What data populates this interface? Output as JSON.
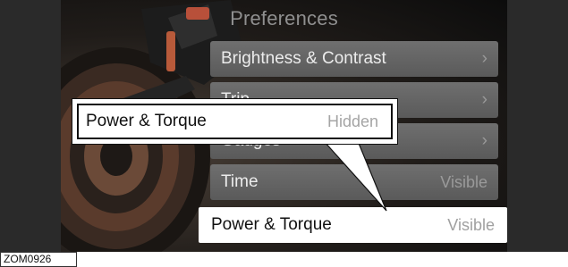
{
  "screen": {
    "title": "Preferences"
  },
  "menu": {
    "items": [
      {
        "label": "Brightness & Contrast",
        "value": "",
        "chevron": "›"
      },
      {
        "label": "Trip",
        "value": "",
        "chevron": "›"
      },
      {
        "label": "Gauges",
        "value": "",
        "chevron": "›"
      },
      {
        "label": "Time",
        "value": "Visible",
        "chevron": ""
      }
    ],
    "selected": {
      "label": "Power & Torque",
      "value": "Visible"
    }
  },
  "callout": {
    "label": "Power & Torque",
    "value": "Hidden"
  },
  "figure_code": "ZOM0926",
  "icons": {
    "chevron": "chevron-right-icon"
  },
  "colors": {
    "menu_bg": "#646464",
    "selected_bg": "#ffffff",
    "frame": "#2a2a2a"
  }
}
